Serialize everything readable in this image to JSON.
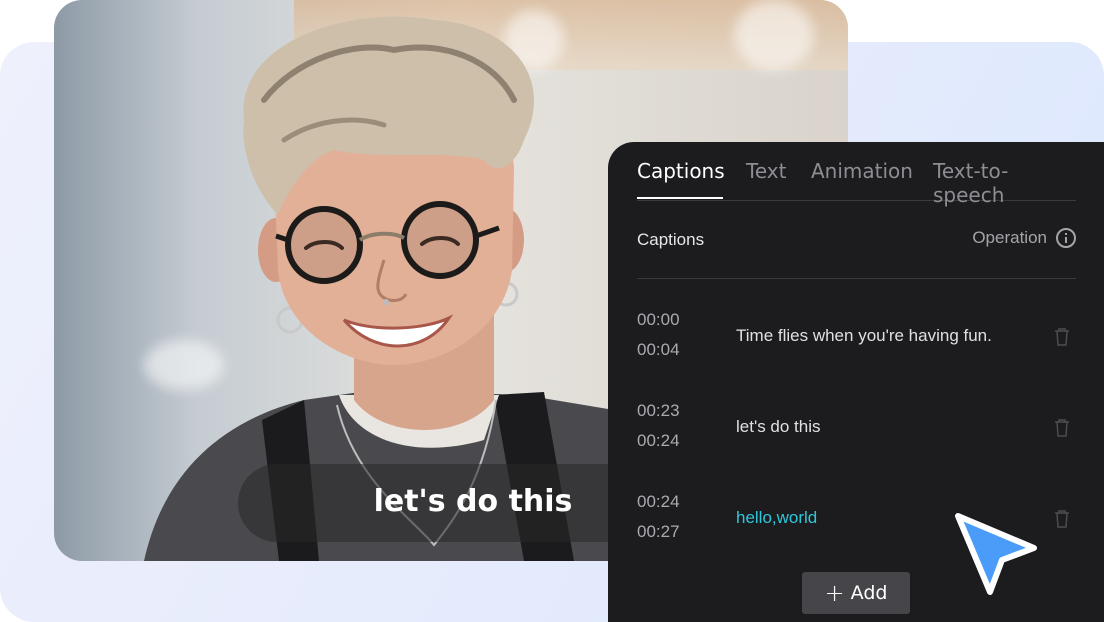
{
  "video": {
    "subtitle": "let's do this"
  },
  "panel": {
    "tabs": [
      {
        "label": "Captions",
        "active": true
      },
      {
        "label": "Text",
        "active": false
      },
      {
        "label": "Animation",
        "active": false
      },
      {
        "label": "Text-to-speech",
        "active": false
      }
    ],
    "section_title": "Captions",
    "operation_label": "Operation",
    "captions": [
      {
        "start": "00:00",
        "end": "00:04",
        "text": "Time flies when you're having fun."
      },
      {
        "start": "00:23",
        "end": "00:24",
        "text": "let's do this"
      },
      {
        "start": "00:24",
        "end": "00:27",
        "text": "hello,world"
      }
    ],
    "add_label": "Add"
  },
  "colors": {
    "panel_bg": "#1c1c1f",
    "highlight": "#2ec8da",
    "cursor": "#4a9cf8"
  }
}
